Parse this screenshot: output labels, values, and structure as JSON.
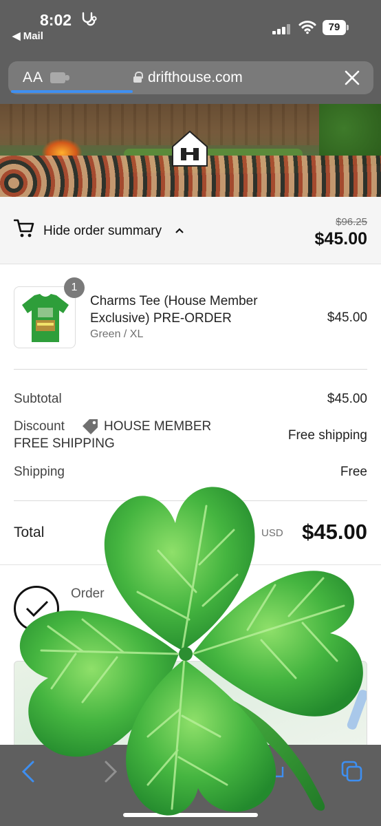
{
  "status_bar": {
    "time": "8:02",
    "back_app": "Mail",
    "battery": "79"
  },
  "browser": {
    "text_size_label": "AA",
    "url": "drifthouse.com"
  },
  "order_summary": {
    "toggle_label": "Hide order summary",
    "original_price": "$96.25",
    "price": "$45.00"
  },
  "line_item": {
    "quantity": "1",
    "name": "Charms Tee (House Member Exclusive) PRE-ORDER",
    "variant": "Green / XL",
    "price": "$45.00"
  },
  "totals": {
    "subtotal_label": "Subtotal",
    "subtotal_value": "$45.00",
    "discount_label": "Discount",
    "discount_code_line1": "HOUSE MEMBER",
    "discount_code_line2": "FREE SHIPPING",
    "discount_value": "Free shipping",
    "shipping_label": "Shipping",
    "shipping_value": "Free",
    "total_label": "Total",
    "currency": "USD",
    "total_value": "$45.00"
  },
  "confirmation": {
    "order_label": "Order"
  },
  "icons": {
    "cart": "cart-icon",
    "chevron": "chevron-up-icon",
    "tag": "tag-icon",
    "check": "checkmark-icon",
    "close": "close-icon",
    "lock": "lock-icon",
    "back": "back-arrow-icon",
    "forward": "forward-arrow-icon",
    "tabs": "tabs-icon",
    "share": "share-icon",
    "shamrock": "shamrock-sticker"
  },
  "colors": {
    "accent_blue": "#3e8ff1",
    "chrome_gray": "#5f5f5f",
    "shamrock_green": "#3aa43a"
  }
}
